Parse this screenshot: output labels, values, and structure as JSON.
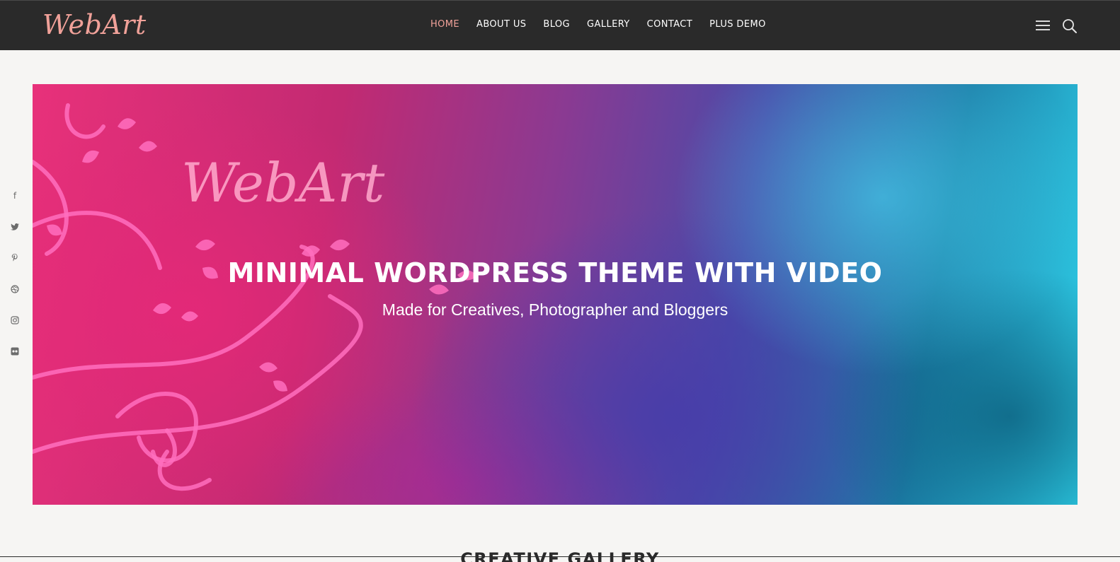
{
  "header": {
    "logo": "WebArt",
    "nav": [
      {
        "label": "HOME",
        "active": true
      },
      {
        "label": "ABOUT US",
        "active": false
      },
      {
        "label": "BLOG",
        "active": false
      },
      {
        "label": "GALLERY",
        "active": false
      },
      {
        "label": "CONTACT",
        "active": false
      },
      {
        "label": "PLUS DEMO",
        "active": false
      }
    ],
    "icons": [
      "hamburger-menu-icon",
      "search-icon"
    ]
  },
  "social": [
    {
      "icon": "facebook-icon",
      "glyph": "f"
    },
    {
      "icon": "twitter-icon",
      "glyph": "🐦"
    },
    {
      "icon": "pinterest-icon",
      "glyph": "P"
    },
    {
      "icon": "dribbble-icon",
      "glyph": "◎"
    },
    {
      "icon": "instagram-icon",
      "glyph": "▣"
    },
    {
      "icon": "flickr-icon",
      "glyph": "●●"
    }
  ],
  "hero": {
    "logo": "WebArt",
    "title": "MINIMAL WORDPRESS THEME WITH VIDEO",
    "subtitle": "Made for Creatives, Photographer and Bloggers"
  },
  "section": {
    "heading": "CREATIVE GALLERY"
  },
  "colors": {
    "header_bg": "#2a2a2a",
    "accent": "#f0a199",
    "page_bg": "#f6f5f3"
  }
}
